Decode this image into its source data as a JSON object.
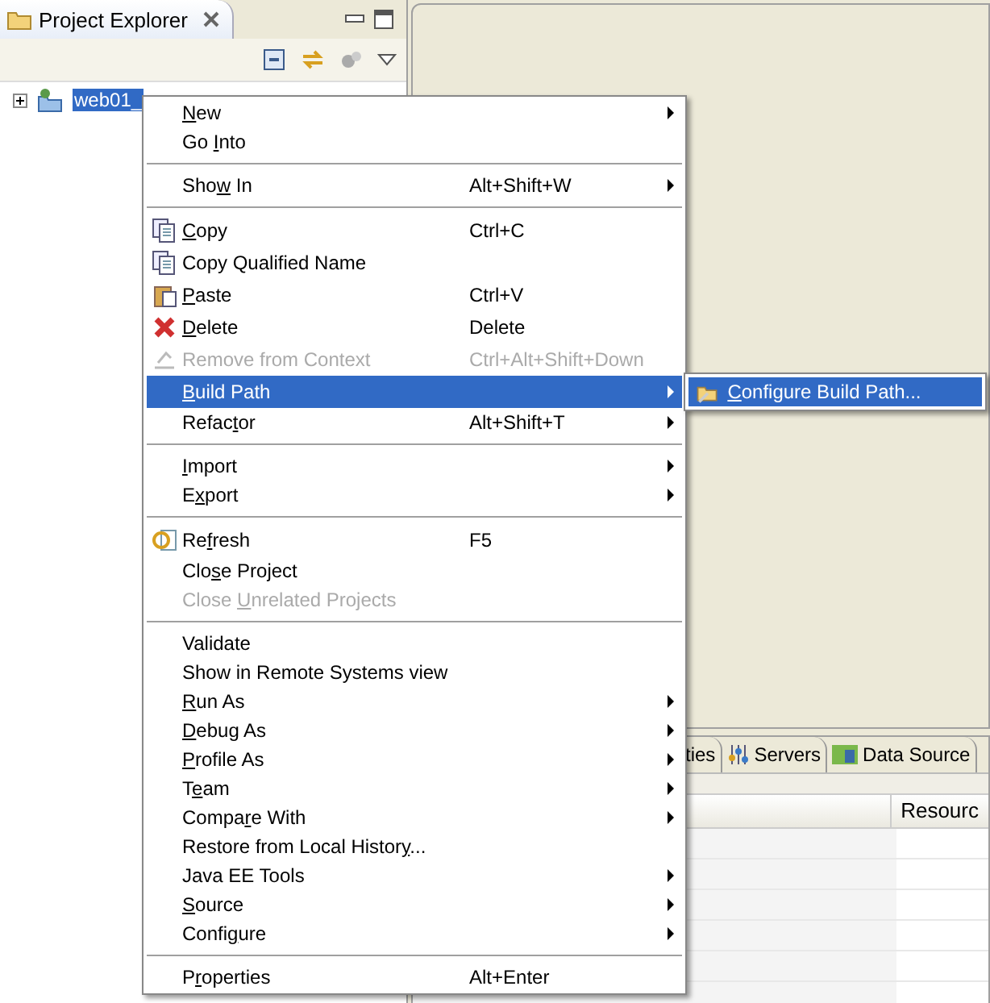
{
  "explorer": {
    "title": "Project Explorer",
    "tree": [
      {
        "label": "web01_",
        "expanded": false,
        "selected": true
      }
    ]
  },
  "context_menu": [
    {
      "kind": "plain",
      "key": "N",
      "post": "ew",
      "submenu": true,
      "disabled": false,
      "selected": false
    },
    {
      "kind": "plain",
      "pre": "Go ",
      "key": "I",
      "post": "nto",
      "submenu": false,
      "disabled": false,
      "selected": false
    },
    {
      "kind": "separator"
    },
    {
      "kind": "plain",
      "pre": "Sho",
      "key": "w",
      "post": " In",
      "shortcut": "Alt+Shift+W",
      "submenu": true,
      "disabled": false,
      "selected": false
    },
    {
      "kind": "separator"
    },
    {
      "kind": "copy",
      "key": "C",
      "post": "opy",
      "shortcut": "Ctrl+C",
      "submenu": false,
      "disabled": false,
      "selected": false
    },
    {
      "kind": "copy",
      "pre": "Copy Qualified Name",
      "submenu": false,
      "disabled": false,
      "selected": false
    },
    {
      "kind": "paste",
      "key": "P",
      "post": "aste",
      "shortcut": "Ctrl+V",
      "submenu": false,
      "disabled": false,
      "selected": false
    },
    {
      "kind": "delete",
      "key": "D",
      "post": "elete",
      "shortcut": "Delete",
      "submenu": false,
      "disabled": false,
      "selected": false
    },
    {
      "kind": "remove",
      "pre": "Remove from Context",
      "shortcut": "Ctrl+Alt+Shift+Down",
      "submenu": false,
      "disabled": true,
      "selected": false
    },
    {
      "kind": "plain",
      "key": "B",
      "post": "uild Path",
      "submenu": true,
      "disabled": false,
      "selected": true
    },
    {
      "kind": "plain",
      "pre": "Refac",
      "key": "t",
      "post": "or",
      "shortcut": "Alt+Shift+T",
      "submenu": true,
      "disabled": false,
      "selected": false
    },
    {
      "kind": "separator"
    },
    {
      "kind": "plain",
      "key": "I",
      "post": "mport",
      "submenu": true,
      "disabled": false,
      "selected": false
    },
    {
      "kind": "plain",
      "pre": "E",
      "key": "x",
      "post": "port",
      "submenu": true,
      "disabled": false,
      "selected": false
    },
    {
      "kind": "separator"
    },
    {
      "kind": "refresh",
      "pre": "Re",
      "key": "f",
      "post": "resh",
      "shortcut": "F5",
      "submenu": false,
      "disabled": false,
      "selected": false
    },
    {
      "kind": "plain",
      "pre": "Clo",
      "key": "s",
      "post": "e Project",
      "submenu": false,
      "disabled": false,
      "selected": false
    },
    {
      "kind": "plain",
      "pre": "Close ",
      "key": "U",
      "post": "nrelated Projects",
      "submenu": false,
      "disabled": true,
      "selected": false
    },
    {
      "kind": "separator"
    },
    {
      "kind": "plain",
      "pre": "Validate",
      "submenu": false,
      "disabled": false,
      "selected": false
    },
    {
      "kind": "plain",
      "pre": "Show in Remote Systems view",
      "submenu": false,
      "disabled": false,
      "selected": false
    },
    {
      "kind": "plain",
      "key": "R",
      "post": "un As",
      "submenu": true,
      "disabled": false,
      "selected": false
    },
    {
      "kind": "plain",
      "key": "D",
      "post": "ebug As",
      "submenu": true,
      "disabled": false,
      "selected": false
    },
    {
      "kind": "plain",
      "key": "P",
      "post": "rofile As",
      "submenu": true,
      "disabled": false,
      "selected": false
    },
    {
      "kind": "plain",
      "pre": "T",
      "key": "e",
      "post": "am",
      "submenu": true,
      "disabled": false,
      "selected": false
    },
    {
      "kind": "plain",
      "pre": "Compa",
      "key": "r",
      "post": "e With",
      "submenu": true,
      "disabled": false,
      "selected": false
    },
    {
      "kind": "plain",
      "pre": "Restore from Local Histor",
      "key": "y",
      "post": "...",
      "submenu": false,
      "disabled": false,
      "selected": false
    },
    {
      "kind": "plain",
      "pre": "Java EE Tools",
      "submenu": true,
      "disabled": false,
      "selected": false
    },
    {
      "kind": "plain",
      "key": "S",
      "post": "ource",
      "submenu": true,
      "disabled": false,
      "selected": false
    },
    {
      "kind": "plain",
      "pre": "Confi",
      "key": "g",
      "post": "ure",
      "submenu": true,
      "disabled": false,
      "selected": false
    },
    {
      "kind": "separator"
    },
    {
      "kind": "plain",
      "pre": "P",
      "key": "r",
      "post": "operties",
      "shortcut": "Alt+Enter",
      "submenu": false,
      "disabled": false,
      "selected": false
    }
  ],
  "submenu": [
    {
      "key": "C",
      "post": "onfigure Build Path...",
      "selected": true
    }
  ],
  "bottom_panel": {
    "tabs": [
      {
        "label": "ties",
        "selected": false
      },
      {
        "label": "Servers",
        "selected": false
      },
      {
        "label": "Data Source",
        "selected": false
      }
    ],
    "columns": [
      "Resourc"
    ]
  }
}
